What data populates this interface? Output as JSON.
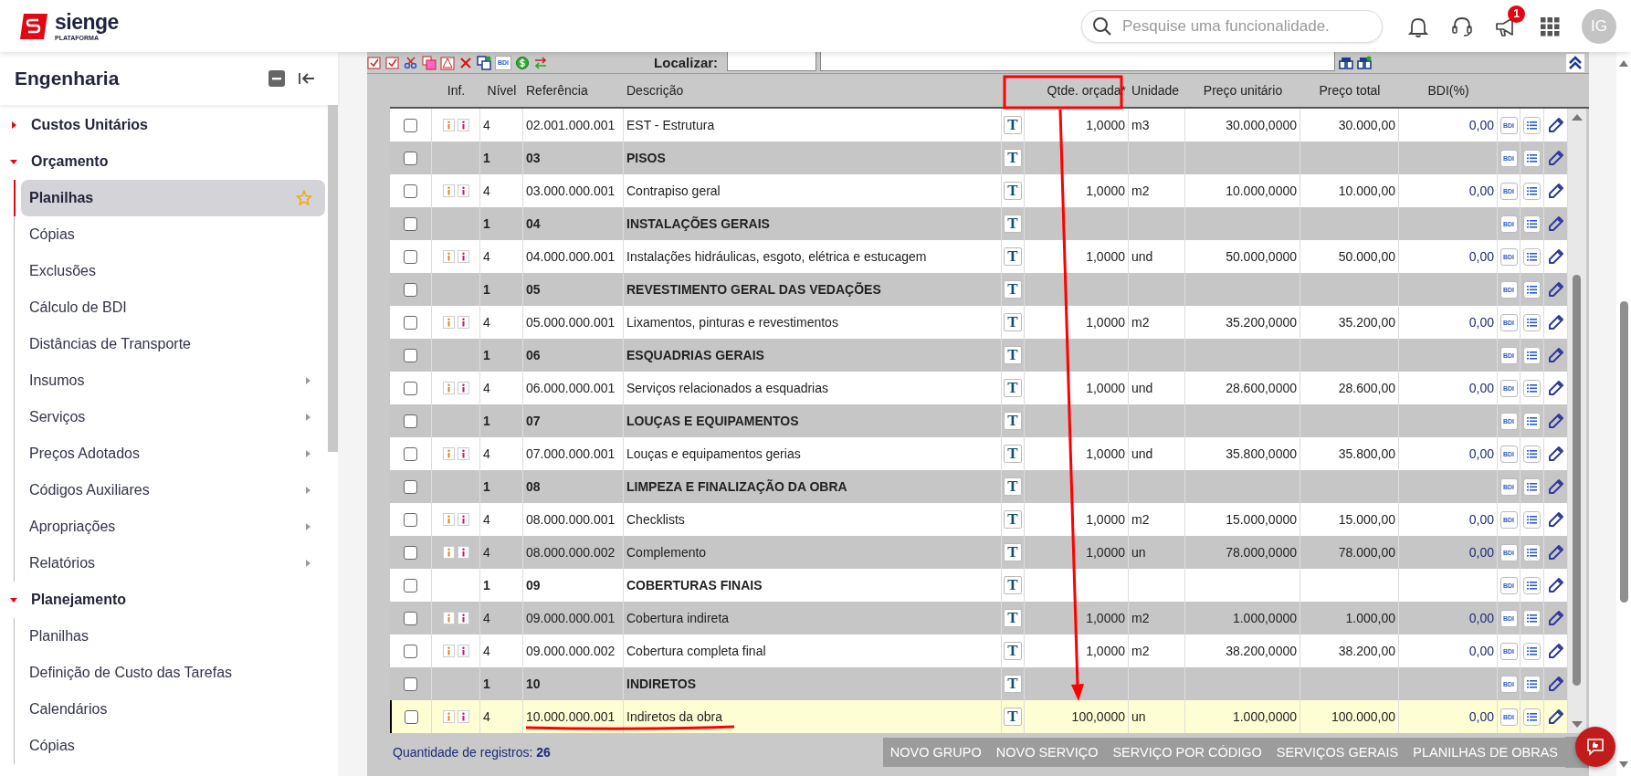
{
  "header": {
    "logo_name": "sienge",
    "logo_sub": "PLATAFORMA",
    "search": {
      "placeholder": "Pesquise uma funcionalidade."
    },
    "notification_badge": "1",
    "avatar": "IG"
  },
  "sidebar": {
    "title": "Engenharia",
    "sections": [
      {
        "label": "Custos Unitários",
        "expanded": false
      },
      {
        "label": "Orçamento",
        "expanded": true,
        "children": [
          {
            "label": "Planilhas",
            "selected": true,
            "has_submenu": false
          },
          {
            "label": "Cópias",
            "selected": false,
            "has_submenu": false
          },
          {
            "label": "Exclusões",
            "selected": false,
            "has_submenu": false
          },
          {
            "label": "Cálculo de BDI",
            "selected": false,
            "has_submenu": false
          },
          {
            "label": "Distâncias de Transporte",
            "selected": false,
            "has_submenu": false
          },
          {
            "label": "Insumos",
            "selected": false,
            "has_submenu": true
          },
          {
            "label": "Serviços",
            "selected": false,
            "has_submenu": true
          },
          {
            "label": "Preços Adotados",
            "selected": false,
            "has_submenu": true
          },
          {
            "label": "Códigos Auxiliares",
            "selected": false,
            "has_submenu": true
          },
          {
            "label": "Apropriações",
            "selected": false,
            "has_submenu": true
          },
          {
            "label": "Relatórios",
            "selected": false,
            "has_submenu": true
          }
        ]
      },
      {
        "label": "Planejamento",
        "expanded": true,
        "children": [
          {
            "label": "Planilhas",
            "selected": false,
            "has_submenu": false
          },
          {
            "label": "Definição de Custo das Tarefas",
            "selected": false,
            "has_submenu": false
          },
          {
            "label": "Calendários",
            "selected": false,
            "has_submenu": false
          },
          {
            "label": "Cópias",
            "selected": false,
            "has_submenu": false
          }
        ]
      }
    ]
  },
  "toolbar": {
    "bdi_button": "BDI",
    "search_label": "Localizar:"
  },
  "table": {
    "columns": [
      "Inf.",
      "Nível",
      "Referência",
      "Descrição",
      "Qtde. orçada*",
      "Unidade",
      "Preço unitário",
      "Preço total",
      "BDI(%)"
    ],
    "rows": [
      {
        "kind": "item",
        "checked": false,
        "selected": false,
        "level": "4",
        "ref": "02.001.000.001",
        "desc": "EST - Estrutura",
        "t": "T",
        "qty": "1,0000",
        "unit": "m3",
        "unit_price": "30.000,0000",
        "total": "30.000,00",
        "bdi": "0,00",
        "bdi_button": "BDI"
      },
      {
        "kind": "group",
        "checked": false,
        "selected": false,
        "level": "1",
        "ref": "03",
        "desc": "PISOS",
        "t": "T",
        "bdi_button": "BDI"
      },
      {
        "kind": "item",
        "checked": false,
        "selected": false,
        "level": "4",
        "ref": "03.000.000.001",
        "desc": "Contrapiso geral",
        "t": "T",
        "qty": "1,0000",
        "unit": "m2",
        "unit_price": "10.000,0000",
        "total": "10.000,00",
        "bdi": "0,00",
        "bdi_button": "BDI"
      },
      {
        "kind": "group",
        "checked": false,
        "selected": false,
        "level": "1",
        "ref": "04",
        "desc": "INSTALAÇÕES GERAIS",
        "t": "T",
        "bdi_button": "BDI"
      },
      {
        "kind": "item",
        "checked": false,
        "selected": false,
        "level": "4",
        "ref": "04.000.000.001",
        "desc": "Instalações hidráulicas, esgoto, elétrica e estucagem",
        "t": "T",
        "qty": "1,0000",
        "unit": "und",
        "unit_price": "50.000,0000",
        "total": "50.000,00",
        "bdi": "0,00",
        "bdi_button": "BDI"
      },
      {
        "kind": "group",
        "checked": false,
        "selected": false,
        "level": "1",
        "ref": "05",
        "desc": "REVESTIMENTO GERAL DAS VEDAÇÕES",
        "t": "T",
        "bdi_button": "BDI"
      },
      {
        "kind": "item",
        "checked": false,
        "selected": false,
        "level": "4",
        "ref": "05.000.000.001",
        "desc": "Lixamentos, pinturas e revestimentos",
        "t": "T",
        "qty": "1,0000",
        "unit": "m2",
        "unit_price": "35.200,0000",
        "total": "35.200,00",
        "bdi": "0,00",
        "bdi_button": "BDI"
      },
      {
        "kind": "group",
        "checked": false,
        "selected": false,
        "level": "1",
        "ref": "06",
        "desc": "ESQUADRIAS GERAIS",
        "t": "T",
        "bdi_button": "BDI"
      },
      {
        "kind": "item",
        "checked": false,
        "selected": false,
        "level": "4",
        "ref": "06.000.000.001",
        "desc": "Serviços relacionados a esquadrias",
        "t": "T",
        "qty": "1,0000",
        "unit": "und",
        "unit_price": "28.600,0000",
        "total": "28.600,00",
        "bdi": "0,00",
        "bdi_button": "BDI"
      },
      {
        "kind": "group",
        "checked": false,
        "selected": false,
        "level": "1",
        "ref": "07",
        "desc": "LOUÇAS E EQUIPAMENTOS",
        "t": "T",
        "bdi_button": "BDI"
      },
      {
        "kind": "item",
        "checked": false,
        "selected": false,
        "level": "4",
        "ref": "07.000.000.001",
        "desc": "Louças e equipamentos gerias",
        "t": "T",
        "qty": "1,0000",
        "unit": "und",
        "unit_price": "35.800,0000",
        "total": "35.800,00",
        "bdi": "0,00",
        "bdi_button": "BDI"
      },
      {
        "kind": "group",
        "checked": false,
        "selected": false,
        "level": "1",
        "ref": "08",
        "desc": "LIMPEZA E FINALIZAÇÃO DA OBRA",
        "t": "T",
        "bdi_button": "BDI"
      },
      {
        "kind": "item",
        "checked": false,
        "selected": false,
        "level": "4",
        "ref": "08.000.000.001",
        "desc": "Checklists",
        "t": "T",
        "qty": "1,0000",
        "unit": "m2",
        "unit_price": "15.000,0000",
        "total": "15.000,00",
        "bdi": "0,00",
        "bdi_button": "BDI"
      },
      {
        "kind": "item",
        "checked": false,
        "selected": false,
        "level": "4",
        "ref": "08.000.000.002",
        "desc": "Complemento",
        "t": "T",
        "qty": "1,0000",
        "unit": "un",
        "unit_price": "78.000,0000",
        "total": "78.000,00",
        "bdi": "0,00",
        "bdi_button": "BDI"
      },
      {
        "kind": "group",
        "checked": false,
        "selected": false,
        "level": "1",
        "ref": "09",
        "desc": "COBERTURAS FINAIS",
        "t": "T",
        "bdi_button": "BDI"
      },
      {
        "kind": "item",
        "checked": false,
        "selected": false,
        "level": "4",
        "ref": "09.000.000.001",
        "desc": "Cobertura indireta",
        "t": "T",
        "qty": "1,0000",
        "unit": "m2",
        "unit_price": "1.000,0000",
        "total": "1.000,00",
        "bdi": "0,00",
        "bdi_button": "BDI"
      },
      {
        "kind": "item",
        "checked": false,
        "selected": false,
        "level": "4",
        "ref": "09.000.000.002",
        "desc": "Cobertura completa final",
        "t": "T",
        "qty": "1,0000",
        "unit": "m2",
        "unit_price": "38.200,0000",
        "total": "38.200,00",
        "bdi": "0,00",
        "bdi_button": "BDI"
      },
      {
        "kind": "group",
        "checked": false,
        "selected": false,
        "level": "1",
        "ref": "10",
        "desc": "INDIRETOS",
        "t": "T",
        "bdi_button": "BDI"
      },
      {
        "kind": "item",
        "checked": false,
        "selected": true,
        "level": "4",
        "ref": "10.000.000.001",
        "desc": "Indiretos da obra",
        "t": "T",
        "qty": "100,0000",
        "unit": "un",
        "unit_price": "1.000,0000",
        "total": "100.000,00",
        "bdi": "0,00",
        "bdi_button": "BDI"
      }
    ]
  },
  "footer": {
    "record_count": "Quantidade de registros: **26**",
    "buttons": [
      "NOVO GRUPO",
      "NOVO SERVIÇO",
      "SERVIÇO POR CÓDIGO",
      "SERVIÇOS GERAIS",
      "PLANILHAS DE OBRAS"
    ]
  }
}
